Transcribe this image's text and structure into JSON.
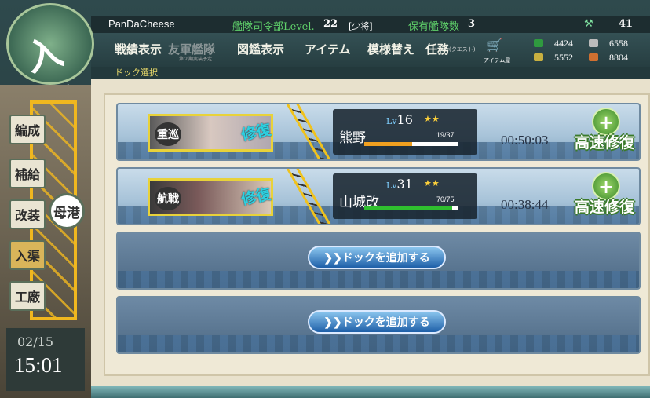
{
  "player": {
    "name": "PanDaCheese",
    "level_label": "艦隊司令部Level.",
    "level": "22",
    "rank": "[少将]",
    "fleet_label": "保有艦隊数",
    "fleet_count": "3",
    "bucket_count": "41"
  },
  "menu": [
    {
      "label": "戦績表示",
      "disabled": false
    },
    {
      "label": "友軍艦隊",
      "disabled": true,
      "sub": "第２期実装予定"
    },
    {
      "label": "図鑑表示",
      "disabled": false
    },
    {
      "label": "アイテム",
      "disabled": false
    },
    {
      "label": "模様替え",
      "disabled": false
    },
    {
      "label": "任務",
      "sub": "(クエスト)",
      "disabled": false
    },
    {
      "label": "アイテム屋",
      "disabled": false
    }
  ],
  "resources": {
    "fuel": "4424",
    "steel": "6558",
    "ammo": "5552",
    "bauxite": "8804"
  },
  "breadcrumb": "ドック選択",
  "logo_text": "入渠",
  "sidebar": {
    "buttons": [
      "編成",
      "補給",
      "改装",
      "入渠",
      "工廠"
    ],
    "harbor": "母港",
    "date": "02/15",
    "time": "15:01"
  },
  "docks": [
    {
      "type_label": "重巡",
      "stamp": "修復",
      "lv_prefix": "Lv",
      "level": "16",
      "stars": "★★",
      "ship_name": "熊野",
      "hp": "19/37",
      "hp_ratio": 0.51,
      "hp_color": "#f0a020",
      "timer": "00:50:03",
      "fast_label": "高速修復",
      "fast_icon": "+"
    },
    {
      "type_label": "航戦",
      "stamp": "修復",
      "lv_prefix": "Lv",
      "level": "31",
      "stars": "★★",
      "ship_name": "山城改",
      "hp": "70/75",
      "hp_ratio": 0.93,
      "hp_color": "#2fbf2f",
      "timer": "00:38:44",
      "fast_label": "高速修復",
      "fast_icon": "+"
    }
  ],
  "add_dock_label": "❯❯ドックを追加する"
}
